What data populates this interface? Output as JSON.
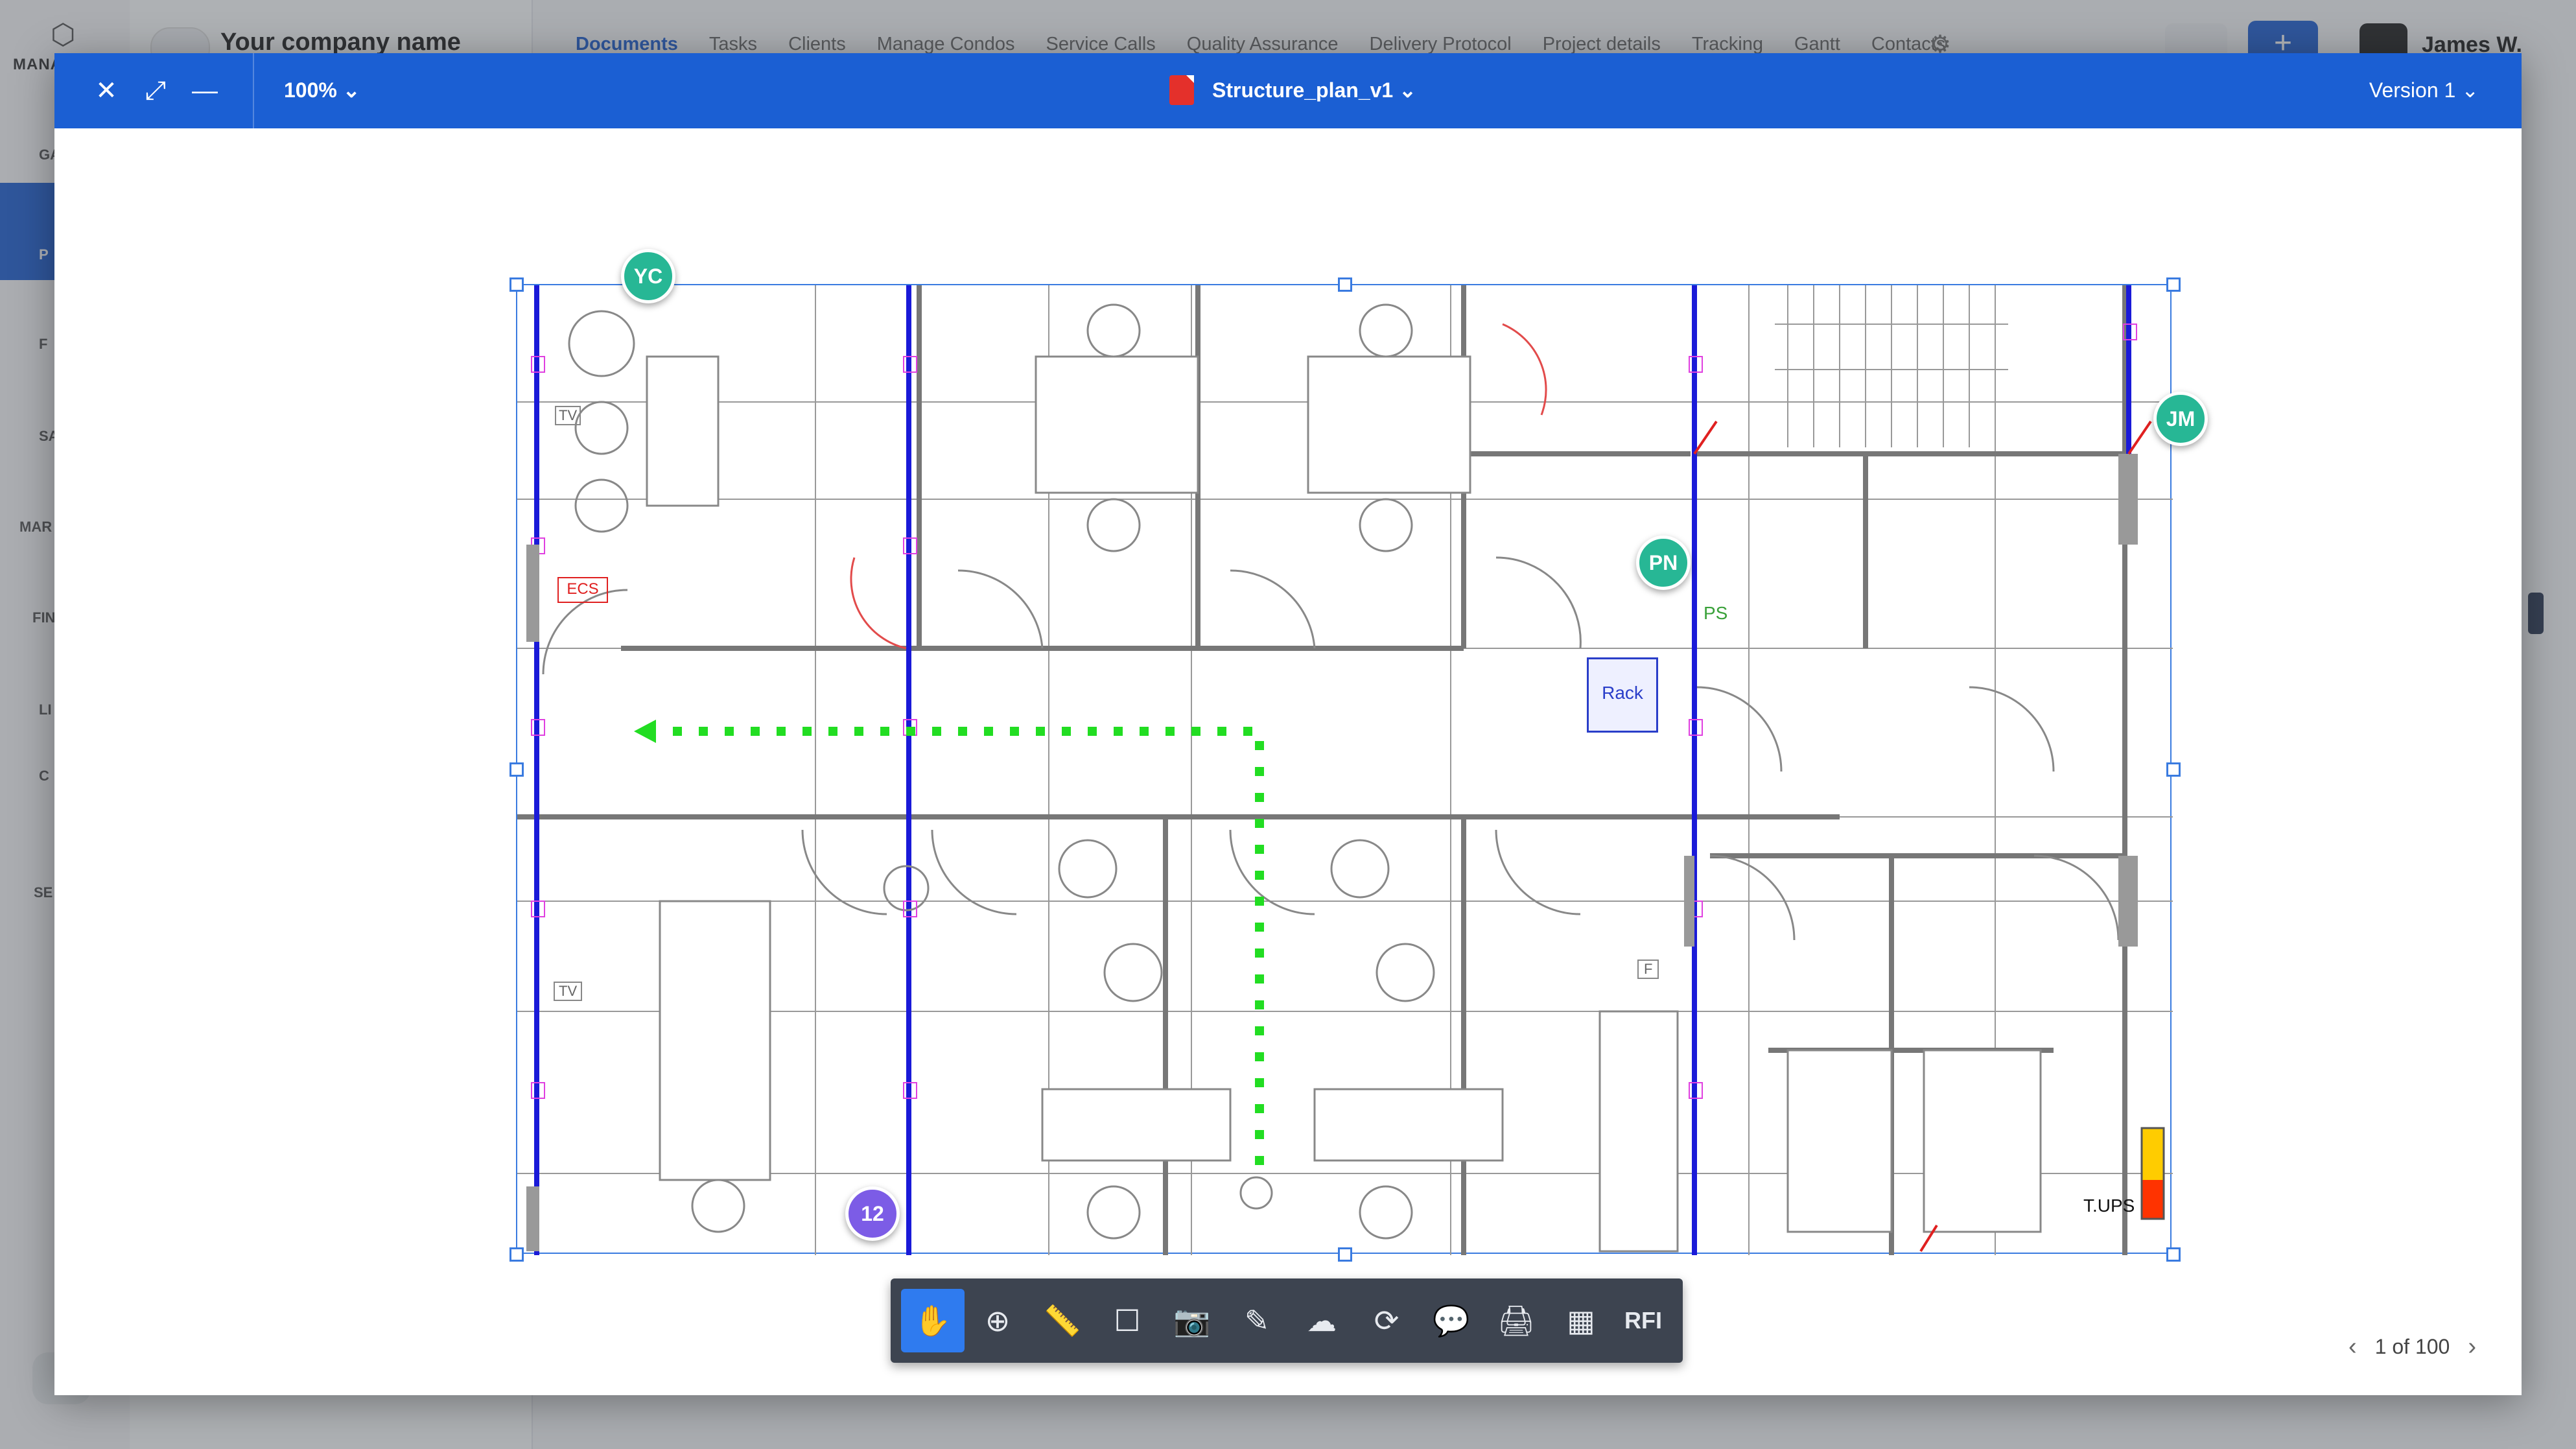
{
  "background": {
    "company_name": "Your company name",
    "brand": "MANA",
    "sidebar_items": [
      "GA",
      "P",
      "F",
      "SA",
      "MAR",
      "FIN",
      "LI",
      "C",
      "SE"
    ],
    "nav_tabs": [
      "Documents",
      "Tasks",
      "Clients",
      "Manage Condos",
      "Service Calls",
      "Quality Assurance",
      "Delivery Protocol",
      "Project details",
      "Tracking",
      "Gantt",
      "Contacts"
    ],
    "active_tab": "Documents",
    "user_name": "James W.",
    "pager_text": "1 of 100"
  },
  "viewer": {
    "zoom": "100%",
    "file_title": "Structure_plan_v1",
    "version": "Version 1",
    "page_indicator": "1 of 100"
  },
  "plan": {
    "labels": {
      "ecs": "ECS",
      "rack": "Rack",
      "ps": "PS",
      "tups": "T.UPS",
      "tv_top": "TV",
      "tv_bottom": "TV",
      "f_box": "F"
    },
    "avatars": [
      {
        "initials": "YC",
        "color": "#27b795"
      },
      {
        "initials": "JM",
        "color": "#27b795"
      },
      {
        "initials": "PN",
        "color": "#27b795"
      },
      {
        "initials": "12",
        "color": "#7c5ce6"
      }
    ],
    "colors": {
      "selection": "#3a7be0",
      "walls_blue": "#1a1ad8",
      "evac_path": "#22dd22",
      "markers_magenta": "#e040e0"
    }
  },
  "toolbar": {
    "tools": [
      {
        "name": "hand-icon",
        "active": true
      },
      {
        "name": "zoom-in-icon"
      },
      {
        "name": "measure-icon"
      },
      {
        "name": "rectangle-icon"
      },
      {
        "name": "camera-icon"
      },
      {
        "name": "pencil-icon"
      },
      {
        "name": "cloud-icon"
      },
      {
        "name": "refresh-icon"
      },
      {
        "name": "comment-icon"
      },
      {
        "name": "print-icon"
      },
      {
        "name": "grid-icon"
      }
    ],
    "rfi_label": "RFI"
  }
}
